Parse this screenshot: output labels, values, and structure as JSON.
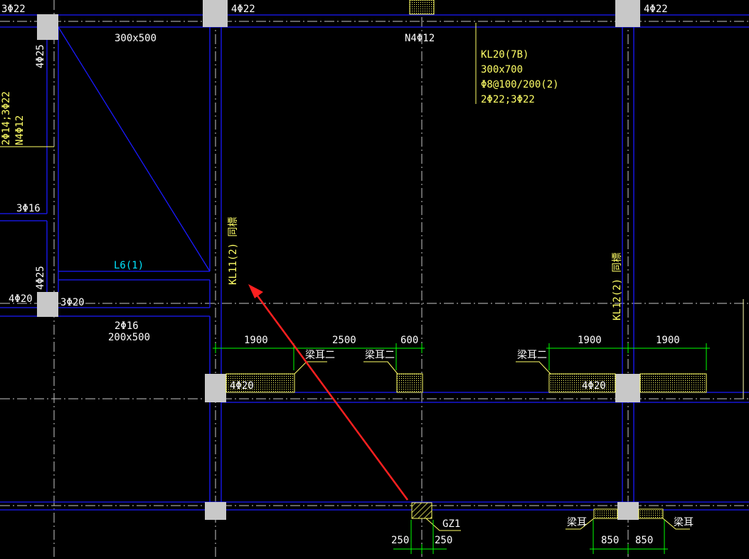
{
  "colors": {
    "background": "#000000",
    "beam_line": "#1a1aff",
    "axis_line": "#c8c8c8",
    "column_fill": "#c8c8c8",
    "dimension_line": "#00ff00",
    "annotation_text": "#ffff66",
    "beam_label_text": "#00e5ff",
    "dimension_text": "#ffffff",
    "arrow": "#ff2020"
  },
  "top_labels": {
    "rebar_3phi22": "3Φ22",
    "rebar_4phi22_a": "4Φ22",
    "rebar_4phi22_b": "4Φ22",
    "beam_size_300x500": "300x500",
    "waist_bar": "N4Φ12"
  },
  "kl20": {
    "name": "KL20(7B)",
    "size": "300x700",
    "stirrup": "Φ8@100/200(2)",
    "main_bars": "2Φ22;3Φ22"
  },
  "left_labels": {
    "col_4phi25_top": "4Φ25",
    "col_4phi25_mid": "4Φ25",
    "side_bars": "2Φ14;3Φ22",
    "side_waist": "N4Φ12",
    "rebar_3phi16": "3Φ16",
    "rebar_4phi20_left": "4Φ20",
    "rebar_3phi20": "3Φ20",
    "rebar_2phi16": "2Φ16",
    "beam_size_200x500": "200x500"
  },
  "beams": {
    "l6": "L6(1)",
    "kl11": "KL11(2)  同標",
    "kl12": "KL12(2)  同標"
  },
  "dimensions": {
    "d1900_a": "1900",
    "d2500": "2500",
    "d600": "600",
    "d1900_b": "1900",
    "d1900_c": "1900",
    "d250_a": "250",
    "d250_b": "250",
    "d850_a": "850",
    "d850_b": "850"
  },
  "tags": {
    "ear_a": "梁耳二",
    "ear_b": "梁耳二",
    "ear_c": "梁耳二",
    "ear_d": "梁耳",
    "ear_e": "梁耳",
    "gz1": "GZ1"
  },
  "middle_labels": {
    "rebar_4phi20_a": "4Φ20",
    "rebar_4phi20_b": "4Φ20"
  }
}
